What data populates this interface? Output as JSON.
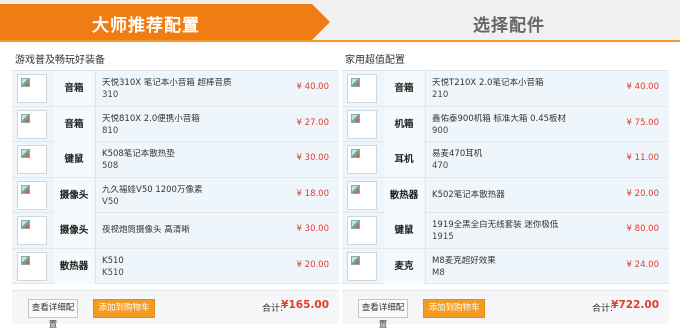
{
  "tabs": {
    "active_label": "大师推荐配置",
    "inactive_label": "选择配件"
  },
  "left": {
    "title": "游戏普及畅玩好装备",
    "items": [
      {
        "category": "音箱",
        "name": "天悦310X 笔记本小音箱 超棒音质",
        "model": "310",
        "price": "¥ 40.00"
      },
      {
        "category": "音箱",
        "name": "天悦810X 2.0便携小音箱",
        "model": "810",
        "price": "¥ 27.00"
      },
      {
        "category": "键鼠",
        "name": "K508笔记本散热垫",
        "model": "508",
        "price": "¥ 30.00"
      },
      {
        "category": "摄像头",
        "name": "九久福娃V50 1200万像素",
        "model": "V50",
        "price": "¥ 18.00"
      },
      {
        "category": "摄像头",
        "name": "夜视炮筒摄像头 高清晰",
        "model": "",
        "price": "¥ 30.00"
      },
      {
        "category": "散热器",
        "name": "K510",
        "model": "K510",
        "price": "¥ 20.00"
      }
    ],
    "detail_button": "查看详细配置",
    "cart_button": "添加到购物车",
    "total_label": "合计:",
    "total_value": "¥165.00"
  },
  "right": {
    "title": "家用超值配置",
    "items": [
      {
        "category": "音箱",
        "name": "天悦T210X 2.0笔记本小音箱",
        "model": "210",
        "price": "¥ 40.00"
      },
      {
        "category": "机箱",
        "name": "鑫佑泰900机箱 标准大箱 0.45板材",
        "model": "900",
        "price": "¥ 75.00"
      },
      {
        "category": "耳机",
        "name": "易麦470耳机",
        "model": "470",
        "price": "¥ 11.00"
      },
      {
        "category": "散热器",
        "name": "K502笔记本散热器",
        "model": "",
        "price": "¥ 20.00"
      },
      {
        "category": "键鼠",
        "name": "1919全黑全白无线套装 迷你极低",
        "model": "1915",
        "price": "¥ 80.00"
      },
      {
        "category": "麦克",
        "name": "M8麦克超好效果",
        "model": "M8",
        "price": "¥ 24.00"
      }
    ],
    "detail_button": "查看详细配置",
    "cart_button": "添加到购物车",
    "total_label": "合计:",
    "total_value": "¥722.00"
  },
  "colors": {
    "accent": "#f07c14",
    "price": "#e43b2c",
    "row_bg": "#eef6fb"
  },
  "icons": {
    "thumbnail": "broken-image-icon"
  }
}
